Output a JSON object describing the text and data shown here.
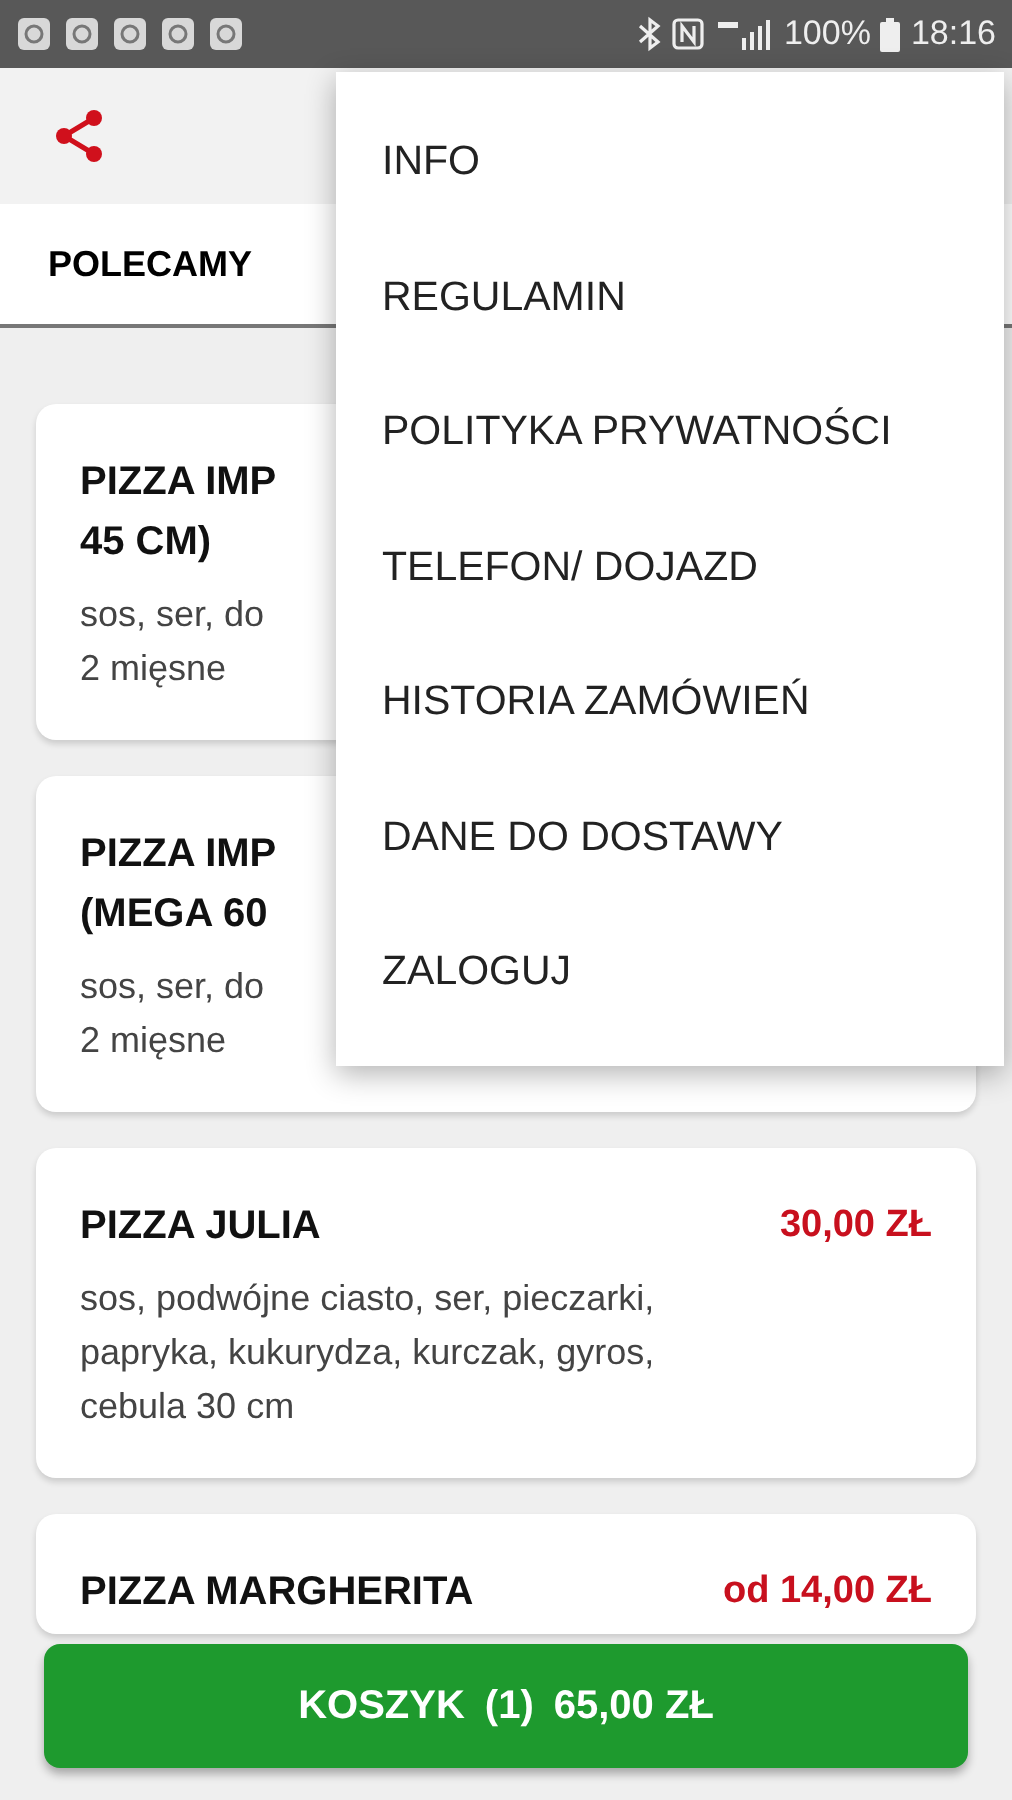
{
  "status_bar": {
    "battery": "100%",
    "time": "18:16"
  },
  "tabs": [
    {
      "label": "POLECAMY",
      "selected": true
    }
  ],
  "products": [
    {
      "title_lines": [
        "PIZZA IMP",
        "45 CM)"
      ],
      "description_lines": [
        "sos, ser, do",
        "2 mięsne"
      ]
    },
    {
      "title_lines": [
        "PIZZA IMP",
        "(MEGA 60"
      ],
      "description_lines": [
        "sos, ser, do",
        "2 mięsne"
      ]
    },
    {
      "title_lines": [
        "PIZZA JULIA"
      ],
      "price": "30,00 ZŁ",
      "description_lines": [
        "sos, podwójne ciasto, ser, pieczarki,",
        "papryka, kukurydza, kurczak, gyros,",
        "cebula 30 cm"
      ]
    },
    {
      "title_lines": [
        "PIZZA MARGHERITA"
      ],
      "price": "od 14,00 ZŁ"
    }
  ],
  "menu": {
    "items": [
      "INFO",
      "REGULAMIN",
      "POLITYKA PRYWATNOŚCI",
      "TELEFON/ DOJAZD",
      "HISTORIA ZAMÓWIEŃ",
      "DANE DO DOSTAWY",
      "ZALOGUJ"
    ]
  },
  "cart_button": {
    "label": "KOSZYK",
    "count": "(1)",
    "total": "65,00 ZŁ"
  }
}
